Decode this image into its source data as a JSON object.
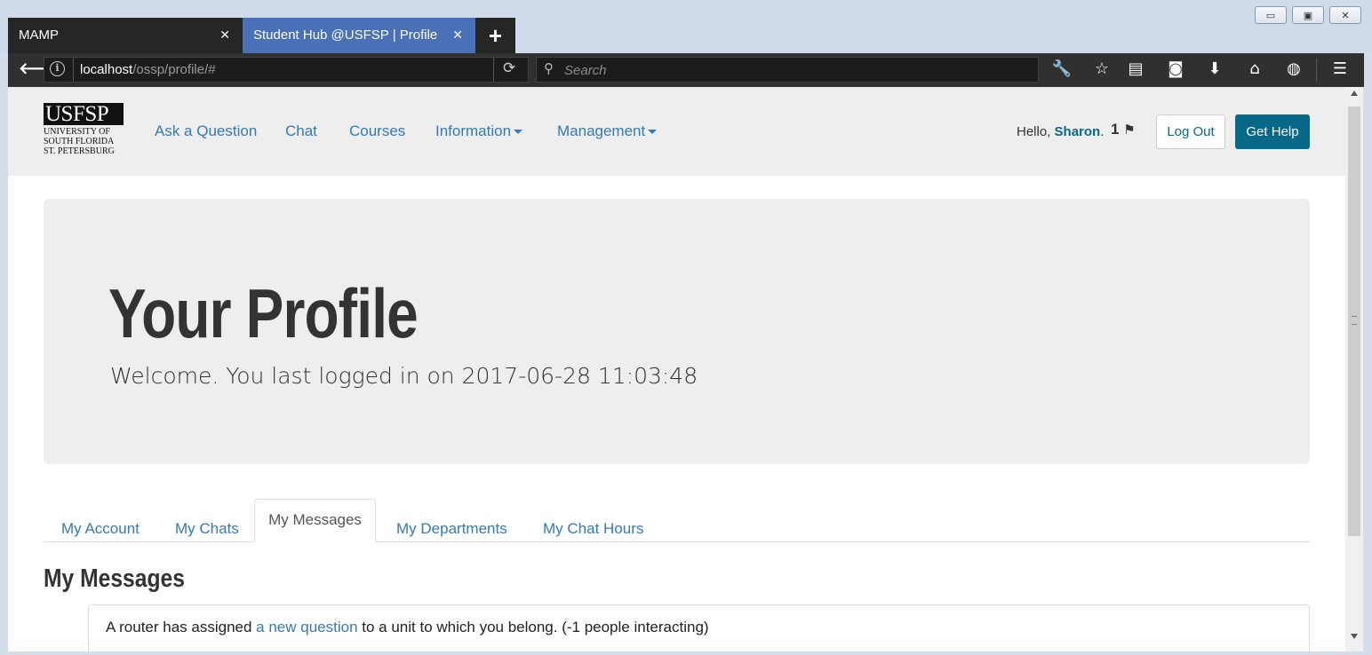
{
  "browser": {
    "tabs": [
      {
        "label": "MAMP",
        "close": "✕"
      },
      {
        "label": "Student Hub @USFSP | Profile",
        "close": "✕"
      }
    ],
    "new_tab": "+",
    "url_host": "localhost",
    "url_path": "/ossp/profile/#",
    "search_placeholder": "Search",
    "window_controls": {
      "minimize": "▭",
      "restore": "▣",
      "close": "✕"
    }
  },
  "header": {
    "logo_wordmark": "USFSP",
    "logo_lines": [
      "UNIVERSITY OF",
      "SOUTH FLORIDA",
      "ST. PETERSBURG"
    ],
    "nav": [
      "Ask a Question",
      "Chat",
      "Courses",
      "Information",
      "Management"
    ],
    "greeting": "Hello,",
    "user_name": "Sharon",
    "greeting_suffix": ".",
    "flag_count": "1",
    "logout_label": "Log Out",
    "help_label": "Get Help"
  },
  "jumbotron": {
    "title": "Your Profile",
    "subtitle": "Welcome. You last logged in on 2017-06-28 11:03:48"
  },
  "profile_tabs": [
    "My Account",
    "My Chats",
    "My Messages",
    "My Departments",
    "My Chat Hours"
  ],
  "active_tab": "My Messages",
  "messages": {
    "heading": "My Messages",
    "item": {
      "before": "A router has assigned ",
      "link": "a new question",
      "after": " to a unit to which you belong. (-1 people interacting)"
    }
  },
  "colors": {
    "link": "#337ab7",
    "help_button": "#07698a",
    "active_browser_tab": "#4a70b8",
    "toolbar": "#303030"
  }
}
